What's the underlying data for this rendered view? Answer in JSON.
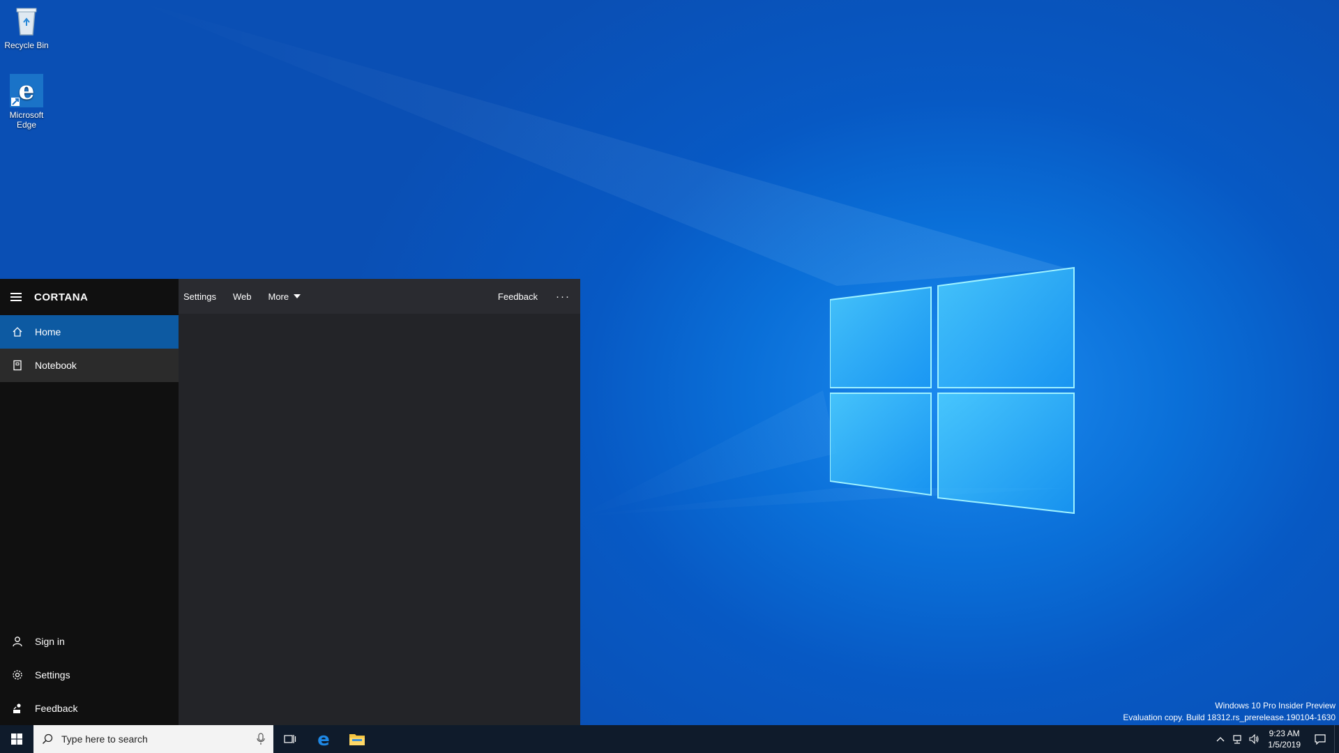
{
  "desktop": {
    "icons": [
      {
        "label": "Recycle Bin"
      },
      {
        "label": "Microsoft Edge"
      }
    ],
    "watermark": {
      "line1": "Windows 10 Pro Insider Preview",
      "line2": "Evaluation copy. Build 18312.rs_prerelease.190104-1630"
    }
  },
  "cortana": {
    "title": "CORTANA",
    "nav": [
      {
        "label": "Home",
        "icon": "home-icon"
      },
      {
        "label": "Notebook",
        "icon": "notebook-icon"
      }
    ],
    "bottom_nav": [
      {
        "label": "Sign in",
        "icon": "person-icon"
      },
      {
        "label": "Settings",
        "icon": "gear-icon"
      },
      {
        "label": "Feedback",
        "icon": "feedback-icon"
      }
    ],
    "tabs": {
      "settings": "Settings",
      "web": "Web",
      "more": "More",
      "feedback": "Feedback",
      "overflow": "···"
    }
  },
  "taskbar": {
    "search_placeholder": "Type here to search",
    "clock_time": "9:23 AM",
    "clock_date": "1/5/2019"
  },
  "colors": {
    "accent": "#0d5aa2",
    "taskbar": "#0f1b2b",
    "panel": "#232428",
    "sidebar": "#101010"
  }
}
